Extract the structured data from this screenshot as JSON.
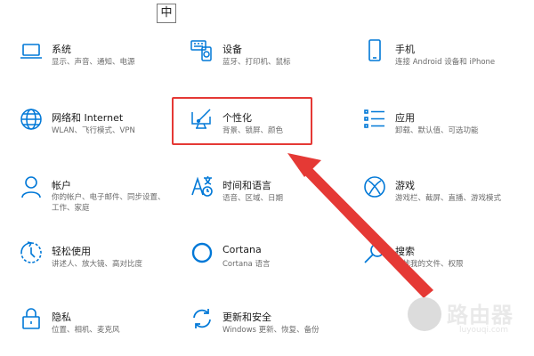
{
  "ime_indicator": "中",
  "tiles": [
    {
      "key": "system",
      "title": "系统",
      "sub": "显示、声音、通知、电源",
      "icon": "laptop-icon"
    },
    {
      "key": "devices",
      "title": "设备",
      "sub": "蓝牙、打印机、鼠标",
      "icon": "keyboard-speaker-icon"
    },
    {
      "key": "phone",
      "title": "手机",
      "sub": "连接 Android 设备和 iPhone",
      "icon": "phone-icon"
    },
    {
      "key": "network",
      "title": "网络和 Internet",
      "sub": "WLAN、飞行模式、VPN",
      "icon": "globe-icon"
    },
    {
      "key": "personalization",
      "title": "个性化",
      "sub": "背景、锁屏、颜色",
      "icon": "paintbrush-monitor-icon"
    },
    {
      "key": "apps",
      "title": "应用",
      "sub": "卸载、默认值、可选功能",
      "icon": "apps-list-icon"
    },
    {
      "key": "accounts",
      "title": "帐户",
      "sub": "你的帐户、电子邮件、同步设置、工作、家庭",
      "icon": "person-icon"
    },
    {
      "key": "time_language",
      "title": "时间和语言",
      "sub": "语音、区域、日期",
      "icon": "language-clock-icon"
    },
    {
      "key": "gaming",
      "title": "游戏",
      "sub": "游戏栏、截屏、直播、游戏模式",
      "icon": "xbox-icon"
    },
    {
      "key": "ease_of_access",
      "title": "轻松使用",
      "sub": "讲述人、放大镜、高对比度",
      "icon": "ease-of-access-icon"
    },
    {
      "key": "cortana",
      "title": "Cortana",
      "sub": "Cortana 语言",
      "icon": "cortana-ring-icon"
    },
    {
      "key": "search",
      "title": "搜索",
      "sub": "查找我的文件、权限",
      "icon": "search-icon"
    },
    {
      "key": "privacy",
      "title": "隐私",
      "sub": "位置、相机、麦克风",
      "icon": "lock-icon"
    },
    {
      "key": "update_security",
      "title": "更新和安全",
      "sub": "Windows 更新、恢复、备份",
      "icon": "sync-arrows-icon"
    }
  ],
  "highlight": {
    "target": "personalization",
    "color": "#e53935"
  },
  "accent_color": "#0078d7",
  "watermark": {
    "name": "路由器",
    "url": "luyouqi.com"
  }
}
